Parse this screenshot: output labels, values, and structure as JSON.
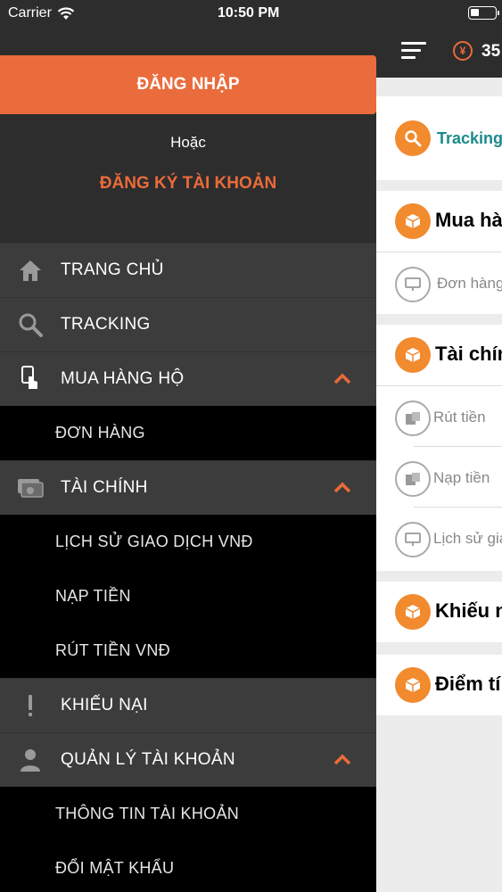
{
  "status_bar": {
    "carrier": "Carrier",
    "time": "10:50 PM"
  },
  "drawer": {
    "login_label": "ĐĂNG NHẬP",
    "or_text": "Hoặc",
    "register_label": "ĐĂNG KÝ TÀI KHOẢN",
    "menu": [
      {
        "label": "TRANG CHỦ",
        "icon": "home-icon"
      },
      {
        "label": "TRACKING",
        "icon": "search-icon"
      },
      {
        "label": "MUA HÀNG HỘ",
        "icon": "hand-pointer-icon",
        "expanded": true,
        "children": [
          "ĐƠN HÀNG"
        ]
      },
      {
        "label": "TÀI CHÍNH",
        "icon": "wallet-icon",
        "expanded": true,
        "children": [
          "LỊCH SỬ GIAO DỊCH VNĐ",
          "NẠP TIỀN",
          "RÚT TIỀN VNĐ"
        ]
      },
      {
        "label": "KHIẾU NẠI",
        "icon": "exclamation-icon"
      },
      {
        "label": "QUẢN LÝ TÀI KHOẢN",
        "icon": "user-icon",
        "expanded": true,
        "children": [
          "THÔNG TIN TÀI KHOẢN",
          "ĐỔI MẬT KHẨU"
        ]
      }
    ]
  },
  "main": {
    "yen_symbol": "¥",
    "balance": "35",
    "tracking_label": "Tracking",
    "sections": [
      {
        "title": "Mua hà",
        "rows": [
          "Đơn hàng"
        ]
      },
      {
        "title": "Tài chín",
        "rows": [
          "Rút tiền",
          "Nạp tiền",
          "Lịch sử gia"
        ]
      },
      {
        "title": "Khiếu n",
        "rows": []
      },
      {
        "title": "Điểm tí",
        "rows": []
      }
    ]
  },
  "colors": {
    "accent": "#ea6b3b",
    "drawer_bg": "#2d2d2d",
    "menu_bg": "#3c3c3c",
    "submenu_bg": "#000000",
    "tracking_teal": "#1b8a8a",
    "card_icon_orange": "#f28a2e"
  }
}
